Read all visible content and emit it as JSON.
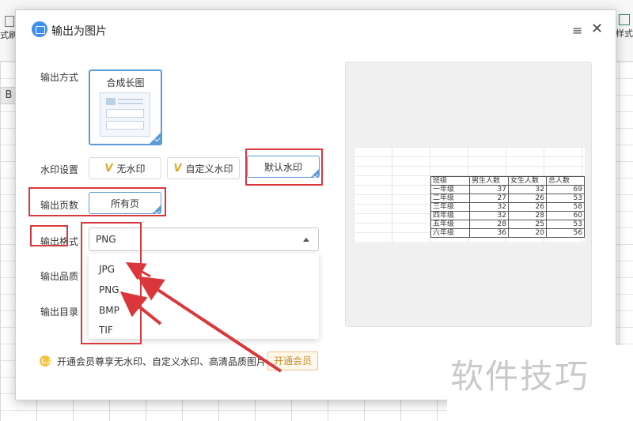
{
  "background": {
    "toolbar_left_label": "式刷",
    "toolbar_right_label": "样式",
    "column_header": "B"
  },
  "dialog": {
    "title": "输出为图片",
    "menu_icon": "≡",
    "close_icon": "✕",
    "output_mode": {
      "label": "输出方式",
      "option": "合成长图"
    },
    "watermark": {
      "label": "水印设置",
      "options": [
        "无水印",
        "自定义水印",
        "默认水印"
      ],
      "vip_mark": "V",
      "selected": "默认水印"
    },
    "pages": {
      "label": "输出页数",
      "option": "所有页"
    },
    "format": {
      "label": "输出格式",
      "selected": "PNG",
      "options": [
        "JPG",
        "PNG",
        "BMP",
        "TIF"
      ]
    },
    "quality": {
      "label": "输出品质"
    },
    "directory": {
      "label": "输出目录"
    },
    "promo": {
      "text": "开通会员尊享无水印、自定义水印、高清品质图片",
      "button": "开通会员"
    },
    "preview": {
      "table_header": [
        "班级",
        "男生人数",
        "女生人数",
        "总人数"
      ],
      "rows": [
        [
          "一年级",
          "37",
          "32",
          "69"
        ],
        [
          "二年级",
          "27",
          "26",
          "53"
        ],
        [
          "三年级",
          "32",
          "26",
          "58"
        ],
        [
          "四年级",
          "32",
          "28",
          "60"
        ],
        [
          "五年级",
          "28",
          "25",
          "53"
        ],
        [
          "六年级",
          "36",
          "20",
          "56"
        ]
      ]
    }
  },
  "watermark_text": "软件技巧",
  "colors": {
    "accent": "#5b9ad8",
    "highlight": "#d9373b",
    "vip": "#e0a526"
  }
}
